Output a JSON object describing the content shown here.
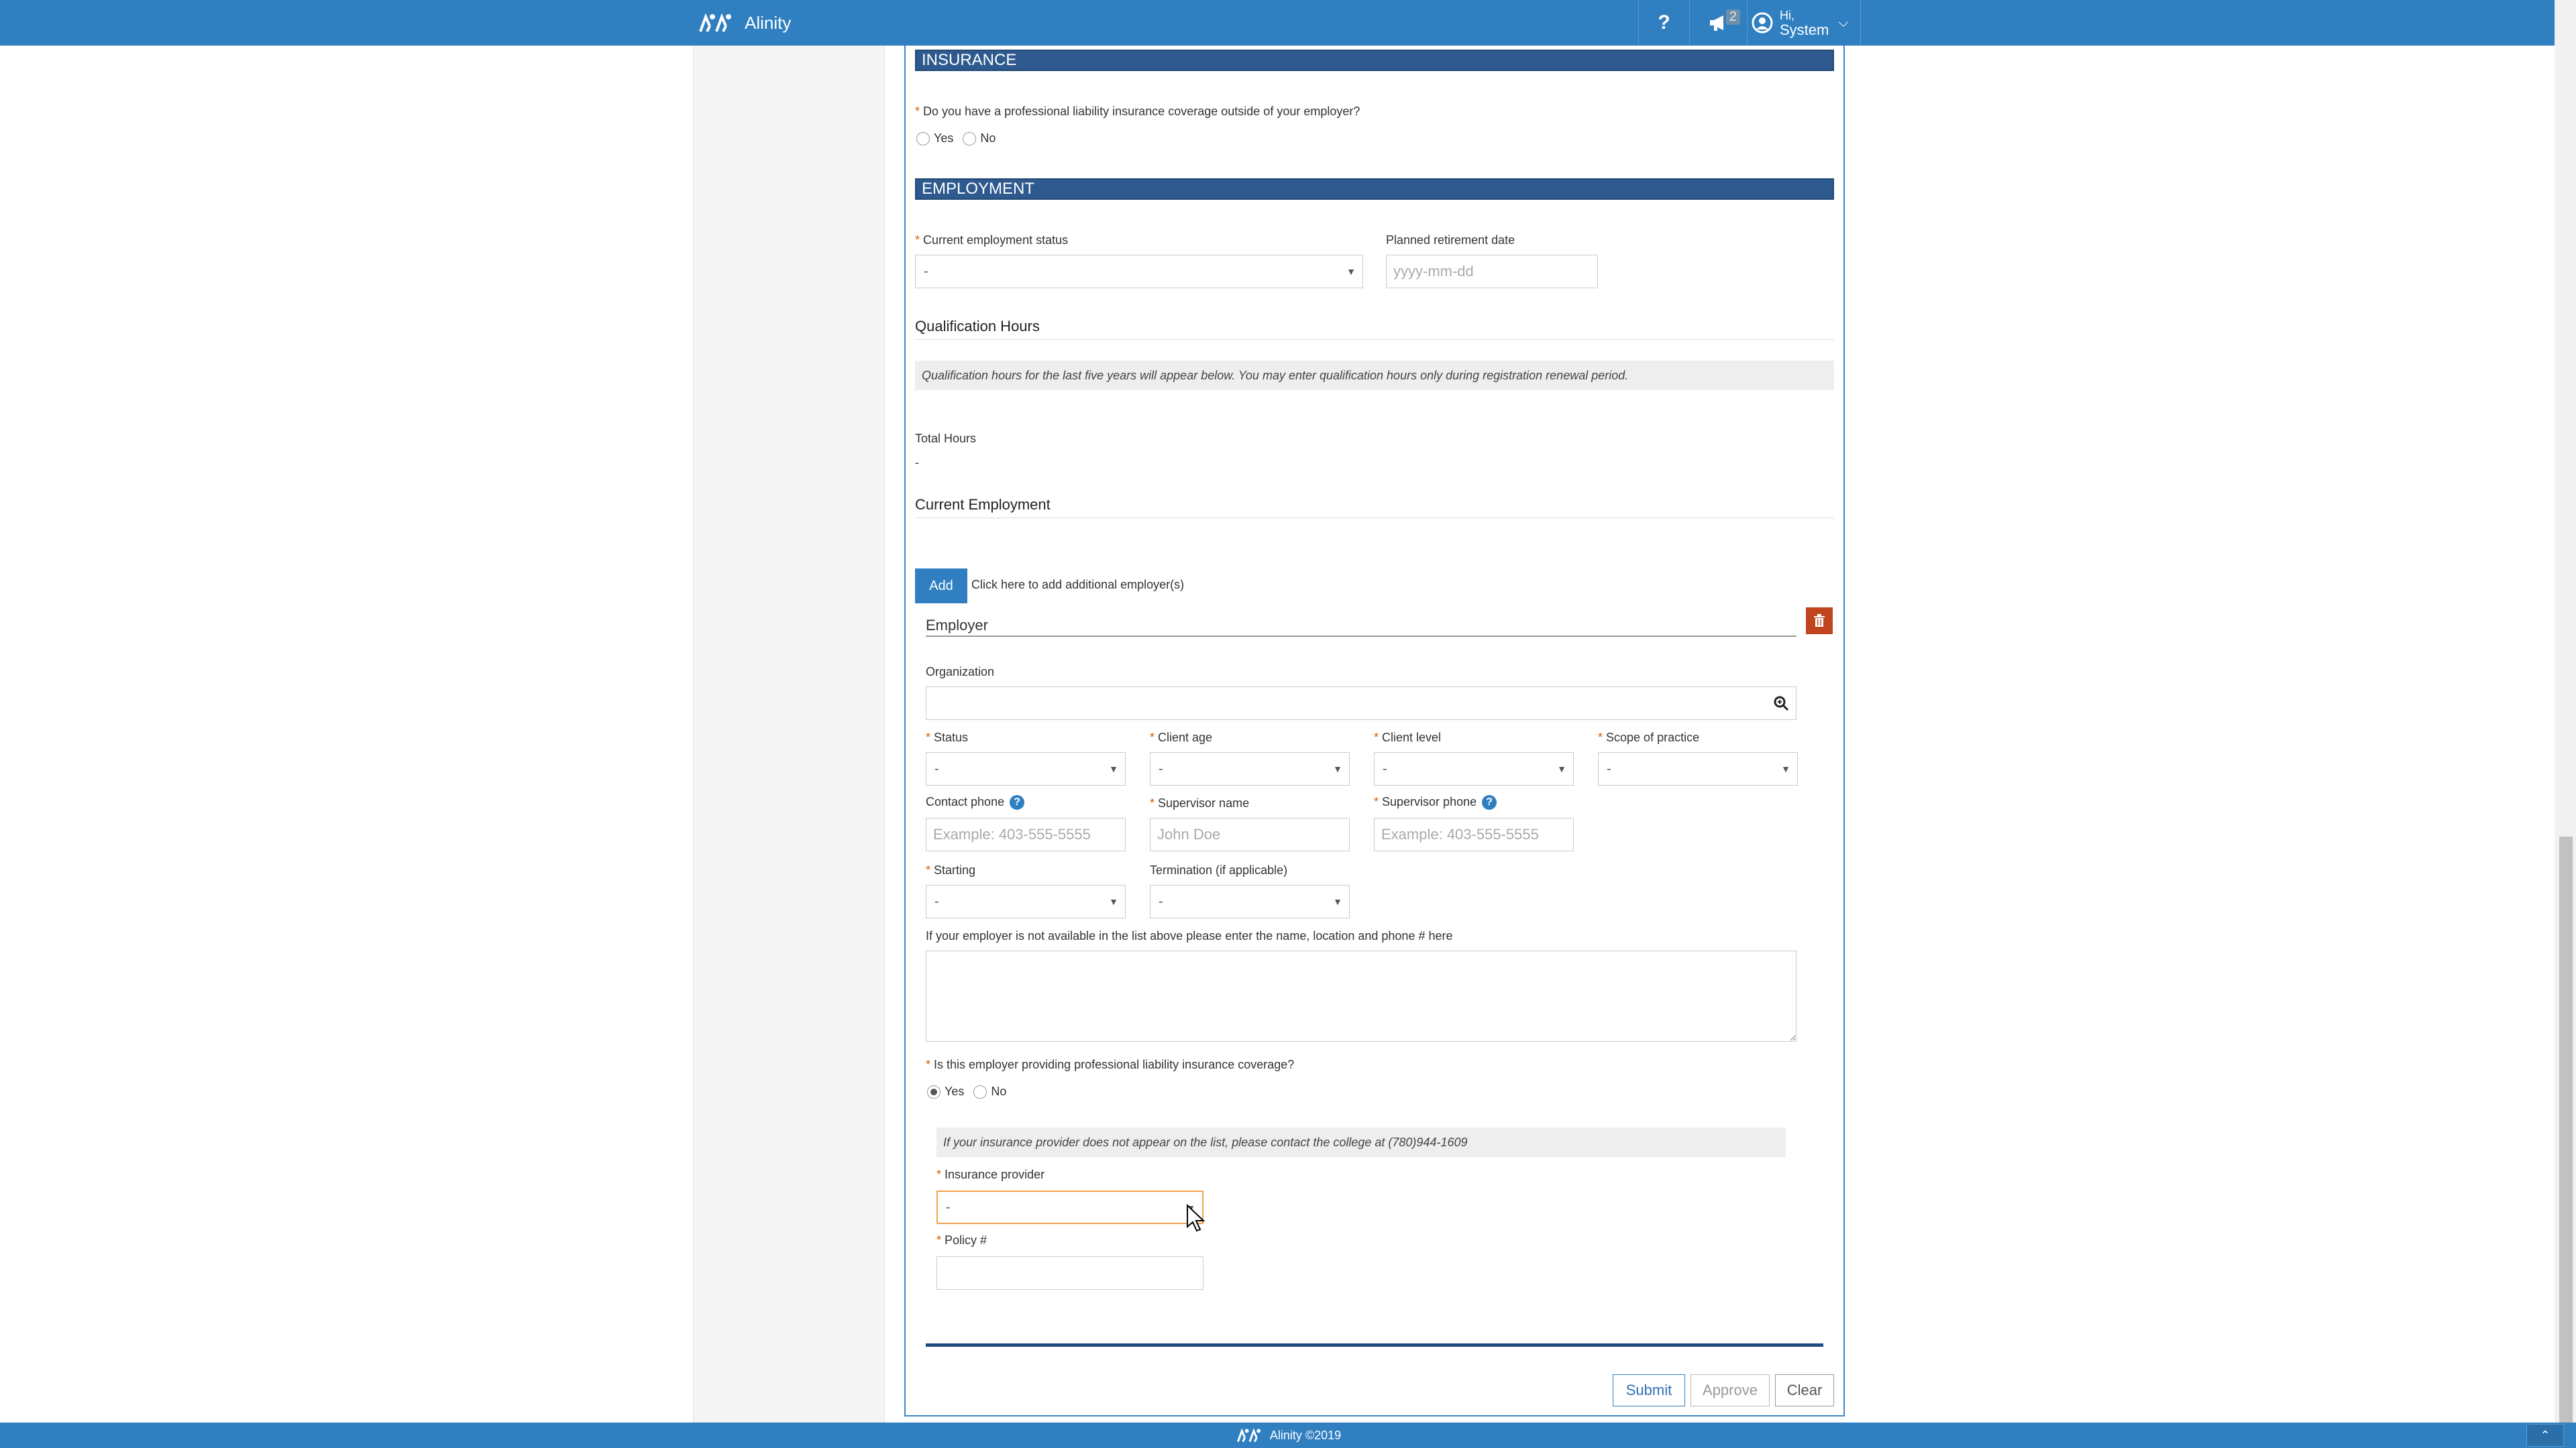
{
  "app": {
    "brand": "Alinity"
  },
  "topnav": {
    "help_label": "?",
    "notifications_count": "2",
    "user_greeting": "Hi,",
    "user_name": "System"
  },
  "insurance": {
    "header": "INSURANCE",
    "question": "Do you have a professional liability insurance coverage outside of your employer?",
    "yes_label": "Yes",
    "no_label": "No"
  },
  "employment": {
    "header": "EMPLOYMENT",
    "status_label": "Current employment status",
    "status_value": "-",
    "retirement_label": "Planned retirement date",
    "retirement_placeholder": "yyyy-mm-dd"
  },
  "qualification": {
    "heading": "Qualification Hours",
    "info": "Qualification hours for the last five years will appear below. You may enter qualification hours only during registration renewal period.",
    "total_label": "Total Hours",
    "total_value": "-"
  },
  "current_employment": {
    "heading": "Current Employment",
    "add_label": "Add",
    "add_hint": "Click here to add additional employer(s)"
  },
  "employer": {
    "title": "Employer",
    "organization_label": "Organization",
    "status_label": "Status",
    "status_value": "-",
    "client_age_label": "Client age",
    "client_age_value": "-",
    "client_level_label": "Client level",
    "client_level_value": "-",
    "scope_label": "Scope of practice",
    "scope_value": "-",
    "contact_phone_label": "Contact phone",
    "contact_phone_placeholder": "Example: 403-555-5555",
    "supervisor_name_label": "Supervisor name",
    "supervisor_name_placeholder": "John Doe",
    "supervisor_phone_label": "Supervisor phone",
    "supervisor_phone_placeholder": "Example: 403-555-5555",
    "starting_label": "Starting",
    "starting_value": "-",
    "termination_label": "Termination (if applicable)",
    "termination_value": "-",
    "notes_label": "If your employer is not available in the list above please enter the name, location and phone # here",
    "coverage_question": "Is this employer providing professional liability insurance coverage?",
    "coverage_yes": "Yes",
    "coverage_no": "No",
    "provider_info": "If your insurance provider does not appear on the list, please contact the college at (780)944-1609",
    "provider_label": "Insurance provider",
    "provider_value": "-",
    "policy_label": "Policy #"
  },
  "actions": {
    "submit": "Submit",
    "approve": "Approve",
    "clear": "Clear"
  },
  "footer": {
    "copyright": "Alinity ©2019"
  },
  "colors": {
    "brand_blue": "#2f7fc1",
    "section_header": "#2e5a8f",
    "required": "#e05a00",
    "delete": "#c0451e",
    "focus_border": "#f0a24b"
  }
}
